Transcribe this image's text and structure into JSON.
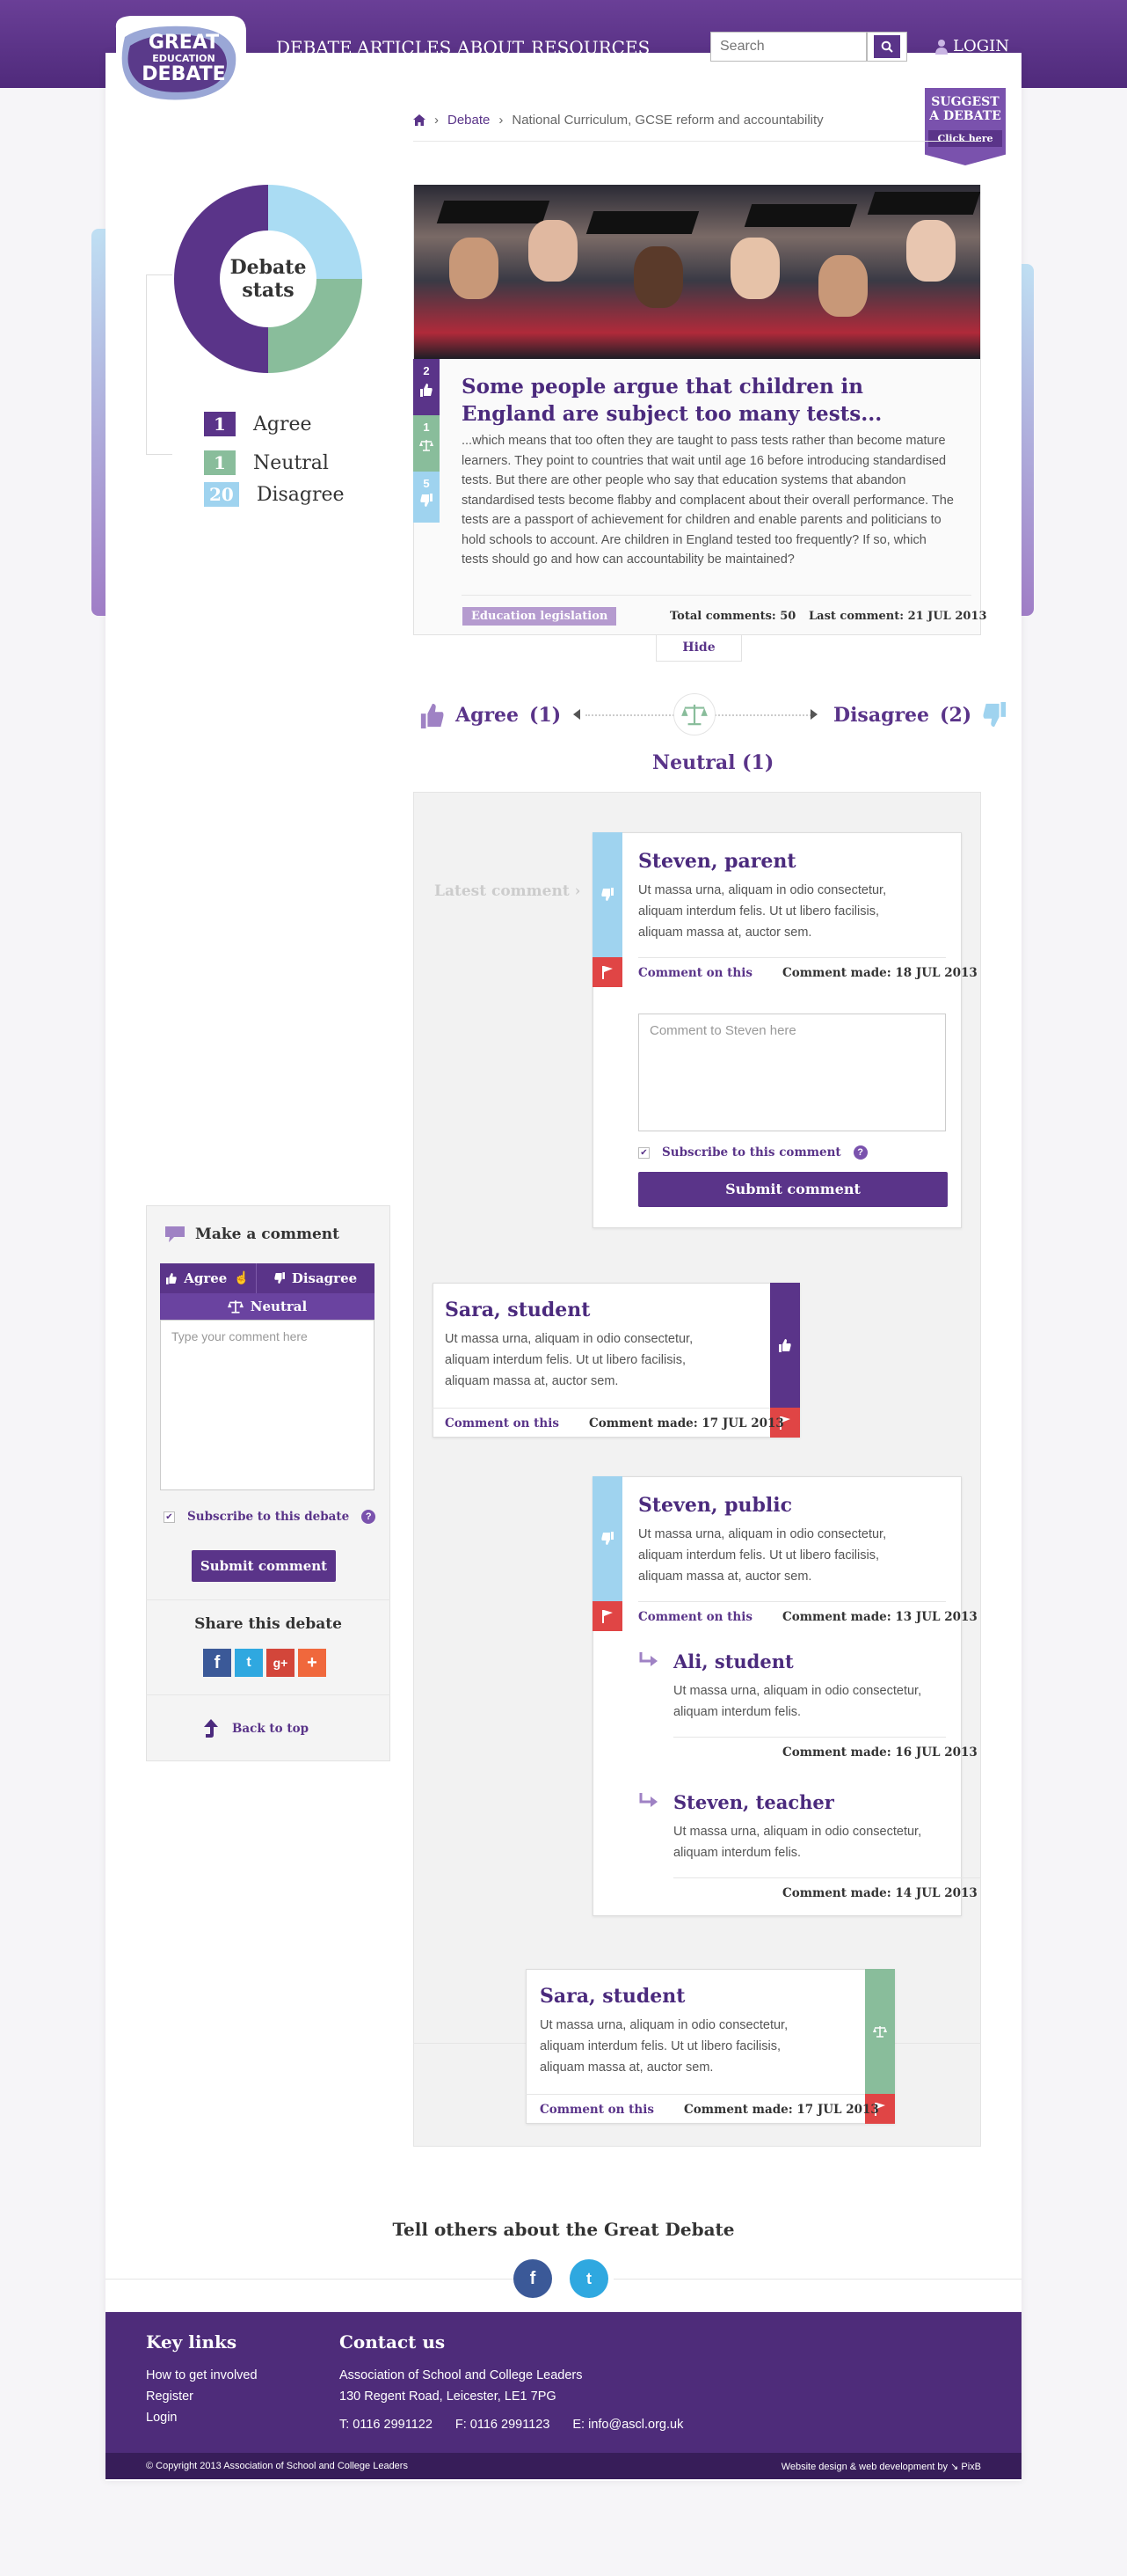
{
  "logo": {
    "line1": "GREAT",
    "line2": "EDUCATION",
    "line3": "DEBATE"
  },
  "nav": {
    "items": [
      "DEBATE",
      "ARTICLES",
      "ABOUT",
      "RESOURCES"
    ],
    "active": "DEBATE"
  },
  "search": {
    "placeholder": "Search"
  },
  "login": {
    "label": "LOGIN"
  },
  "suggest": {
    "line1": "SUGGEST",
    "line2": "A DEBATE",
    "cta": "Click here"
  },
  "breadcrumb": {
    "items": [
      "Debate",
      "National Curriculum, GCSE reform and accountability"
    ]
  },
  "stats": {
    "title_line1": "Debate",
    "title_line2": "stats",
    "rows": [
      {
        "count": "1",
        "label": "Agree",
        "color": "#5a3489"
      },
      {
        "count": "1",
        "label": "Neutral",
        "color": "#89bd9b"
      },
      {
        "count": "20",
        "label": "Disagree",
        "color": "#9fd3ef"
      }
    ]
  },
  "featured": {
    "votes": {
      "agree": "2",
      "neutral": "1",
      "disagree": "5"
    },
    "title": "Some people argue that children in England are subject too many tests...",
    "body": "...which means that too often they are taught to pass tests rather than become mature learners. They point to countries that wait until age 16 before introducing standardised tests. But there are other people who say that education systems that abandon standardised tests become flabby and complacent about their overall performance. The tests are a passport of achievement for children and enable parents and politicians to hold schools to account. Are children in England tested too frequently? If so, which tests should go and how can accountability be maintained?",
    "tag": "Education legislation",
    "total_comments": "Total comments: 50",
    "last_comment": "Last comment: 21 JUL 2013",
    "hide_label": "Hide"
  },
  "switcher": {
    "agree": "Agree",
    "agree_count": "(1)",
    "disagree": "Disagree",
    "disagree_count": "(2)",
    "neutral": "Neutral",
    "neutral_count": "(1)"
  },
  "latest_label": "Latest comment ›",
  "comments": [
    {
      "name": "Steven, parent",
      "text": "Ut massa urna, aliquam in odio consectetur, aliquam interdum felis. Ut ut libero facilisis, aliquam massa at, auctor sem.",
      "link": "Comment on this",
      "date": "Comment made: 18 JUL 2013",
      "stance": "disagree"
    },
    {
      "name": "Sara, student",
      "text": "Ut massa urna, aliquam in odio consectetur, aliquam interdum felis. Ut ut libero facilisis, aliquam massa at, auctor sem.",
      "link": "Comment on this",
      "date": "Comment made: 17 JUL 2013",
      "stance": "agree"
    },
    {
      "name": "Steven, public",
      "text": "Ut massa urna, aliquam in odio consectetur, aliquam interdum felis. Ut ut libero facilisis, aliquam massa at, auctor sem.",
      "link": "Comment on this",
      "date": "Comment made: 13 JUL 2013",
      "stance": "disagree"
    },
    {
      "name": "Sara, student",
      "text": "Ut massa urna, aliquam in odio consectetur, aliquam interdum felis. Ut ut libero facilisis, aliquam massa at, auctor sem.",
      "link": "Comment on this",
      "date": "Comment made: 17 JUL 2013",
      "stance": "neutral"
    }
  ],
  "reply_form": {
    "placeholder": "Comment to Steven here",
    "subscribe": "Subscribe to this comment",
    "submit": "Submit comment"
  },
  "replies": [
    {
      "name": "Ali, student",
      "text": "Ut massa urna, aliquam in odio consectetur, aliquam interdum felis.",
      "date": "Comment made: 16 JUL 2013"
    },
    {
      "name": "Steven, teacher",
      "text": "Ut massa urna, aliquam in odio consectetur, aliquam interdum felis.",
      "date": "Comment made: 14 JUL 2013"
    }
  ],
  "make_comment": {
    "title": "Make a comment",
    "agree": "Agree",
    "disagree": "Disagree",
    "neutral": "Neutral",
    "placeholder": "Type your comment here",
    "subscribe": "Subscribe to this debate",
    "submit": "Submit comment",
    "share_title": "Share this debate",
    "back_to_top": "Back to top"
  },
  "tell_others": "Tell others about the Great Debate",
  "footer": {
    "key_links_title": "Key links",
    "key_links": [
      "How to get involved",
      "Register",
      "Login"
    ],
    "contact_title": "Contact us",
    "org": "Association of School and College Leaders",
    "address": "130 Regent Road, Leicester, LE1 7PG",
    "tel": "T: 0116 2991122",
    "fax": "F: 0116 2991123",
    "email": "E: info@ascl.org.uk",
    "copyright": "© Copyright 2013 Association of School and College Leaders",
    "credit": "Website design & web development by ↘ PixB"
  },
  "colors": {
    "brand": "#5a3489",
    "agree": "#5a3489",
    "neutral": "#89bd9b",
    "disagree": "#9fd3ef",
    "flag": "#e04545"
  }
}
